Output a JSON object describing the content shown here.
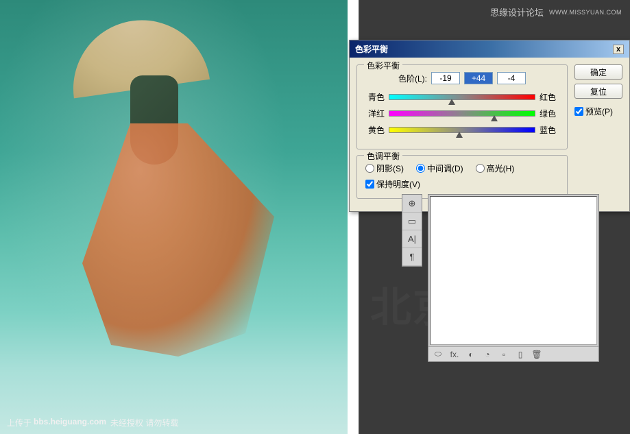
{
  "header": {
    "forum": "思缘设计论坛",
    "url": "WWW.MISSYUAN.COM"
  },
  "watermark": "北京·老屋",
  "canvas": {
    "credit_prefix": "上传于",
    "credit_site": "bbs.heiguang.com",
    "credit_suffix": "未经授权 请勿转载"
  },
  "dialog": {
    "title": "色彩平衡",
    "close": "x",
    "cb_legend": "色彩平衡",
    "level_label": "色阶(L):",
    "levels": [
      "-19",
      "+44",
      "-4"
    ],
    "sliders": [
      {
        "left": "青色",
        "right": "红色",
        "pos": 43
      },
      {
        "left": "洋红",
        "right": "绿色",
        "pos": 72
      },
      {
        "left": "黄色",
        "right": "蓝色",
        "pos": 48
      }
    ],
    "tb_legend": "色调平衡",
    "tones": {
      "shadow": "阴影(S)",
      "mid": "中间调(D)",
      "high": "高光(H)"
    },
    "preserve": "保持明度(V)",
    "ok": "确定",
    "reset": "复位",
    "preview": "预览(P)"
  },
  "tools": [
    "⊕",
    "▭",
    "A|",
    "¶"
  ],
  "layers": {
    "footer_icons": [
      "⬭",
      "fx.",
      "◐",
      "◔",
      "▫",
      "▯",
      "🗑"
    ]
  }
}
